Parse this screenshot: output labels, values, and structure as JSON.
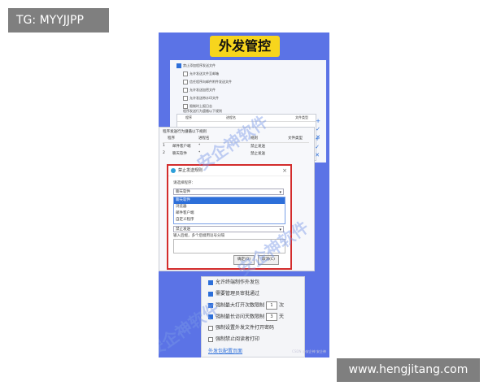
{
  "tags": {
    "top": "TG: MYYJJPP",
    "bottom": "www.hengjitang.com"
  },
  "poster": {
    "title": "外发管控",
    "watermark": "安企神软件",
    "credit": "CSDN @安企神 安企神"
  },
  "panel1": {
    "options": [
      {
        "label": "禁止添加程序发送文件",
        "checked": true
      },
      {
        "label": "允许发送文件至邮箱",
        "checked": false
      },
      {
        "label": "信任程序向邮件附件发送文件",
        "checked": false
      },
      {
        "label": "允许发送加密文件",
        "checked": false
      },
      {
        "label": "允许发送带水印文件",
        "checked": false
      },
      {
        "label": "限制时上报日志",
        "checked": false
      }
    ],
    "table_caption": "程序发送行为遵循以下规则",
    "table_headers": [
      "程序",
      "进程名",
      "文件类型"
    ],
    "icons": [
      "+",
      "✓",
      "✕"
    ]
  },
  "panel2": {
    "title": "程序发送行为遵循以下规则",
    "headers": [
      "程序",
      "进程名",
      "规则",
      "文件类型"
    ],
    "rows": [
      {
        "no": "1",
        "program": "邮件客户端",
        "process": "*",
        "rule": "禁止发送"
      },
      {
        "no": "2",
        "program": "聊天软件",
        "process": "*",
        "rule": "禁止发送"
      }
    ],
    "icons": [
      "+",
      "✓",
      "✕"
    ]
  },
  "dialog": {
    "title": "禁止发送规则",
    "close": "×",
    "label_program": "请选择程序：",
    "selected_program": "聊天软件",
    "dropdown_items": [
      {
        "label": "聊天软件",
        "selected": true
      },
      {
        "label": "浏览器",
        "selected": false
      },
      {
        "label": "邮件客户端",
        "selected": false
      },
      {
        "label": "自定义程序",
        "selected": false
      }
    ],
    "rule_value": "禁止发送",
    "label_input": "输入后缀，多个后缀用逗号分隔",
    "ok": "确定(O)",
    "cancel": "取消(C)"
  },
  "panel3": {
    "options": [
      {
        "label": "允许终端制作外发包",
        "checked": true,
        "value": "",
        "unit": ""
      },
      {
        "label": "需要管理员审批通过",
        "checked": true,
        "value": "",
        "unit": ""
      },
      {
        "label": "强制最大打开次数限制",
        "checked": true,
        "value": "1",
        "unit": "次"
      },
      {
        "label": "强制最长访问天数限制",
        "checked": true,
        "value": "3",
        "unit": "天"
      },
      {
        "label": "强制设置外发文件打开密码",
        "checked": false,
        "value": "",
        "unit": ""
      },
      {
        "label": "强制禁止阅读者打印",
        "checked": false,
        "value": "",
        "unit": ""
      }
    ],
    "link": "外发包配置页面"
  }
}
